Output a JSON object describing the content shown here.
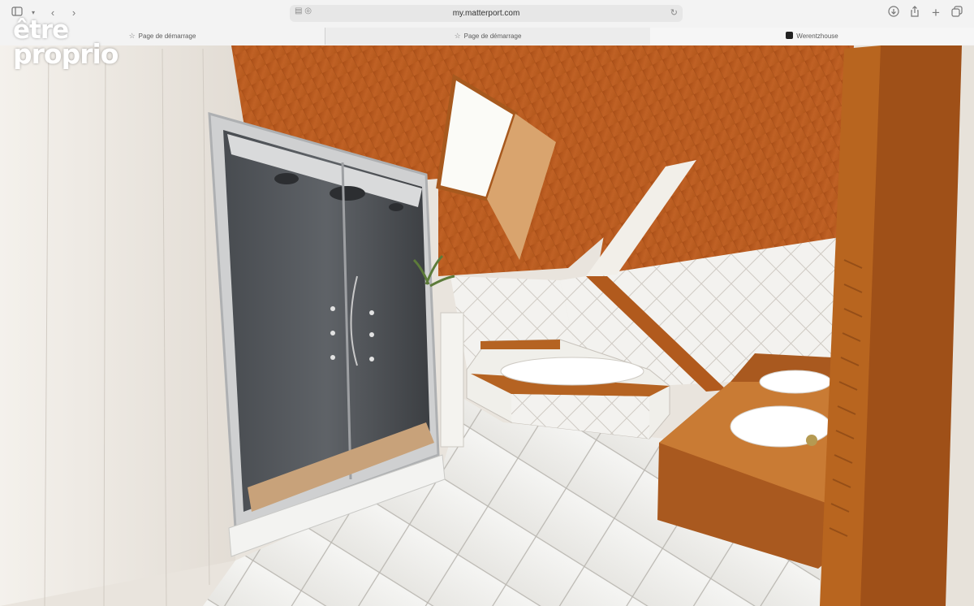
{
  "browser": {
    "url": "my.matterport.com",
    "tabs": [
      {
        "label": "Page de démarrage"
      },
      {
        "label": "Page de démarrage"
      },
      {
        "label": "Werentzhouse"
      }
    ],
    "icons": [
      "sidebar-icon",
      "back-icon",
      "forward-icon",
      "reader-icon",
      "reload-icon",
      "download-icon",
      "share-icon",
      "new-tab-icon",
      "tab-overview-icon"
    ]
  },
  "overlay": {
    "logo_line1": "être",
    "logo_line2": "proprio"
  },
  "scene": {
    "description_colors": {
      "wood": "#b5581c",
      "tile": "#f2f1ee",
      "wall": "#ebe6df"
    }
  }
}
